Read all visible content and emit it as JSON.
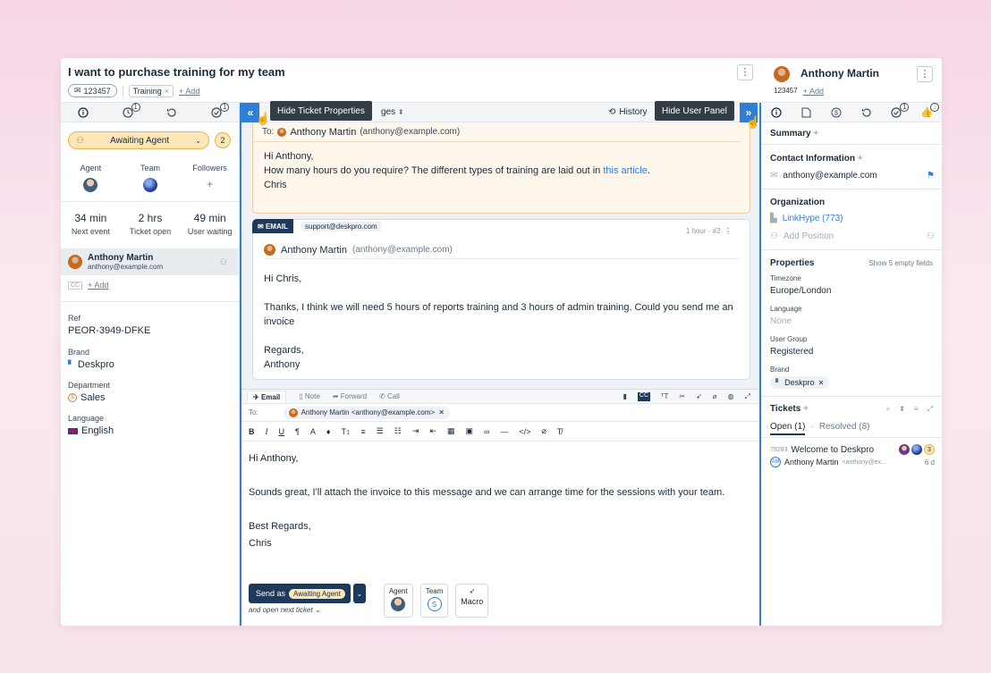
{
  "ticket": {
    "title": "I want to purchase training for my team",
    "id": "123457",
    "tags": [
      "Training"
    ],
    "add_label": "+ Add"
  },
  "left_panel": {
    "tab_counts": [
      "1",
      "1"
    ],
    "status": "Awaiting Agent",
    "status_count": "2",
    "agent_label": "Agent",
    "team_label": "Team",
    "followers_label": "Followers",
    "followers_add": "+",
    "stats": [
      {
        "value": "34 min",
        "label": "Next event"
      },
      {
        "value": "2 hrs",
        "label": "Ticket open"
      },
      {
        "value": "49 min",
        "label": "User waiting"
      }
    ],
    "user_name": "Anthony Martin",
    "user_email": "anthony@example.com",
    "add_cc": "+ Add",
    "ref_label": "Ref",
    "ref_value": "PEOR-3949-DFKE",
    "brand_label": "Brand",
    "brand_value": "Deskpro",
    "department_label": "Department",
    "department_value": "Sales",
    "language_label": "Language",
    "language_value": "English"
  },
  "center": {
    "tooltip_left": "Hide Ticket Properties",
    "messages_label": "ges",
    "history_label": "History",
    "tooltip_right": "Hide User Panel",
    "msg1": {
      "to_label": "To:",
      "to_name": "Anthony Martin",
      "to_email": "(anthony@example.com)",
      "line1": "Hi Anthony,",
      "line2_pre": "How many hours do you require? The different types of training are laid out in",
      "line2_link": "this article",
      "line2_post": ".",
      "line3": "Chris"
    },
    "msg2": {
      "type": "EMAIL",
      "from": "support@deskpro.com",
      "meta": "1 hour · #2",
      "sender_name": "Anthony Martin",
      "sender_email": "(anthony@example.com)",
      "p1": "Hi Chris,",
      "p2": "Thanks, I think we will need 5 hours of reports training and 3 hours of admin training. Could you send me an invoice",
      "p3a": "Regards,",
      "p3b": "Anthony"
    },
    "composer": {
      "tabs": [
        "Email",
        "Note",
        "Forward",
        "Call"
      ],
      "to_label": "To:",
      "to_chip": "Anthony Martin <anthony@example.com>",
      "body1": "Hi Anthony,",
      "body2": "Sounds great, I'll attach the invoice to this message and we can arrange time for the sessions with your team.",
      "body3a": "Best Regards,",
      "body3b": "Chris",
      "send_as": "Send as",
      "send_status": "Awaiting Agent",
      "open_next": "and open next ticket",
      "agent_label": "Agent",
      "team_label": "Team",
      "team_initial": "S",
      "macro_label": "Macro"
    }
  },
  "right_panel": {
    "user_name": "Anthony Martin",
    "user_id": "123457",
    "add_label": "+ Add",
    "tab_counts": [
      "1",
      "1"
    ],
    "summary": "Summary",
    "contact_info": "Contact Information",
    "email": "anthony@example.com",
    "organization": "Organization",
    "org_name": "LinkHype (773)",
    "add_position": "Add Position",
    "properties": "Properties",
    "show_empty": "Show 5 empty fields",
    "timezone_label": "Timezone",
    "timezone_value": "Europe/London",
    "language_label": "Language",
    "language_value": "None",
    "usergroup_label": "User Group",
    "usergroup_value": "Registered",
    "brand_label": "Brand",
    "brand_value": "Deskpro",
    "tickets": "Tickets",
    "open_tab": "Open (1)",
    "resolved_tab": "Resolved (8)",
    "ticket_id": "78283",
    "ticket_subject": "Welcome to Deskpro",
    "ticket_count": "3",
    "ticket_user": "Anthony Martin",
    "ticket_user_email": "<anthony@ex...",
    "ticket_age": "6 d",
    "ticket_user_initials": "AM"
  },
  "colors": {
    "accent": "#2f7ed8",
    "status_bg": "#fde6b8",
    "status_border": "#f0b44a",
    "navy": "#1e3a5a"
  }
}
